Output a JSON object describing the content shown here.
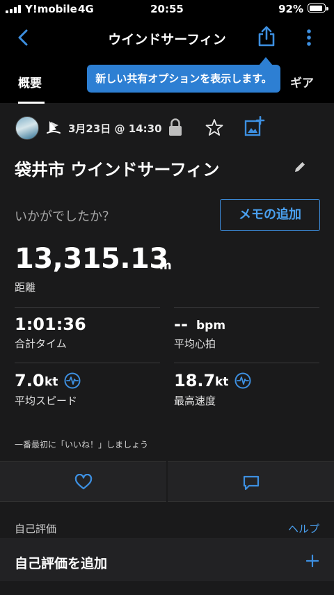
{
  "status": {
    "carrier": "Y!mobile",
    "network": "4G",
    "time": "20:55",
    "battery": "92%",
    "battery_level": 0.92
  },
  "nav": {
    "title": "ウインドサーフィン"
  },
  "tabs": [
    {
      "label": "概要"
    },
    {
      "label": "ギア"
    }
  ],
  "tooltip": {
    "text": "新しい共有オプションを表示します。"
  },
  "meta": {
    "date": "3月23日 @ 14:30"
  },
  "activity": {
    "title": "袋井市 ウインドサーフィン"
  },
  "feedback": {
    "question": "いかがでしたか？",
    "memo_button": "メモの追加"
  },
  "distance": {
    "value": "13,315.13",
    "unit": "m",
    "label": "距離"
  },
  "stats": {
    "time": {
      "value": "1:01:36",
      "label": "合計タイム"
    },
    "heart": {
      "value": "--",
      "unit": "bpm",
      "label": "平均心拍"
    },
    "avg_speed": {
      "value": "7.0",
      "unit": "kt",
      "label": "平均スピード"
    },
    "max_speed": {
      "value": "18.7",
      "unit": "kt",
      "label": "最高速度"
    }
  },
  "social": {
    "like_prompt": "一番最初に「いいね！」しましょう"
  },
  "self_eval": {
    "section_label": "自己評価",
    "help": "ヘルプ",
    "add_label": "自己評価を追加"
  },
  "colors": {
    "accent": "#4aa0f0",
    "tooltip": "#2d7fd3",
    "background": "#1a1a1b"
  }
}
